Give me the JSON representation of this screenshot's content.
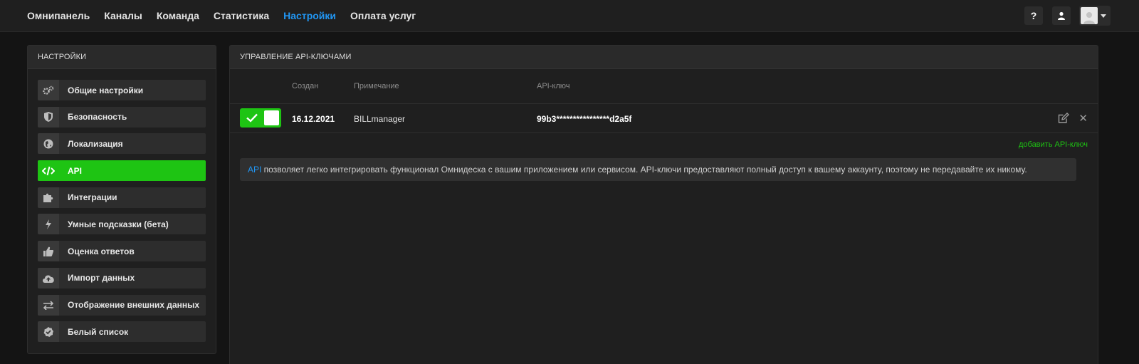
{
  "nav": {
    "items": [
      "Омнипанель",
      "Каналы",
      "Команда",
      "Статистика",
      "Настройки",
      "Оплата услуг"
    ],
    "active_index": 4
  },
  "topbar": {
    "help_label": "?",
    "icons": [
      "help-icon",
      "user-icon",
      "avatar",
      "caret-down-icon"
    ]
  },
  "sidebar": {
    "title": "НАСТРОЙКИ",
    "items": [
      {
        "label": "Общие настройки",
        "icon": "gears-icon"
      },
      {
        "label": "Безопасность",
        "icon": "shield-icon"
      },
      {
        "label": "Локализация",
        "icon": "globe-icon"
      },
      {
        "label": "API",
        "icon": "code-icon"
      },
      {
        "label": "Интеграции",
        "icon": "puzzle-icon"
      },
      {
        "label": "Умные подсказки (бета)",
        "icon": "bolt-icon"
      },
      {
        "label": "Оценка ответов",
        "icon": "thumbs-up-icon"
      },
      {
        "label": "Импорт данных",
        "icon": "cloud-upload-icon"
      },
      {
        "label": "Отображение внешних данных",
        "icon": "exchange-icon"
      },
      {
        "label": "Белый список",
        "icon": "check-badge-icon"
      }
    ],
    "active_index": 3
  },
  "main": {
    "title": "УПРАВЛЕНИЕ API-КЛЮЧАМИ",
    "columns": {
      "created": "Создан",
      "note": "Примечание",
      "key": "API-ключ"
    },
    "rows": [
      {
        "enabled": true,
        "created": "16.12.2021",
        "note": "BILLmanager",
        "key": "99b3****************d2a5f"
      }
    ],
    "add_link": "добавить API-ключ",
    "info_link": "API",
    "info_text": " позволяет легко интегрировать функционал Омнидеска с вашим приложением или сервисом. API-ключи предоставляют полный доступ к вашему аккаунту, поэтому не передавайте их никому."
  },
  "colors": {
    "accent_green": "#1ec413",
    "accent_blue": "#2196f3",
    "background": "#141414",
    "panel": "#1f1f1f"
  }
}
